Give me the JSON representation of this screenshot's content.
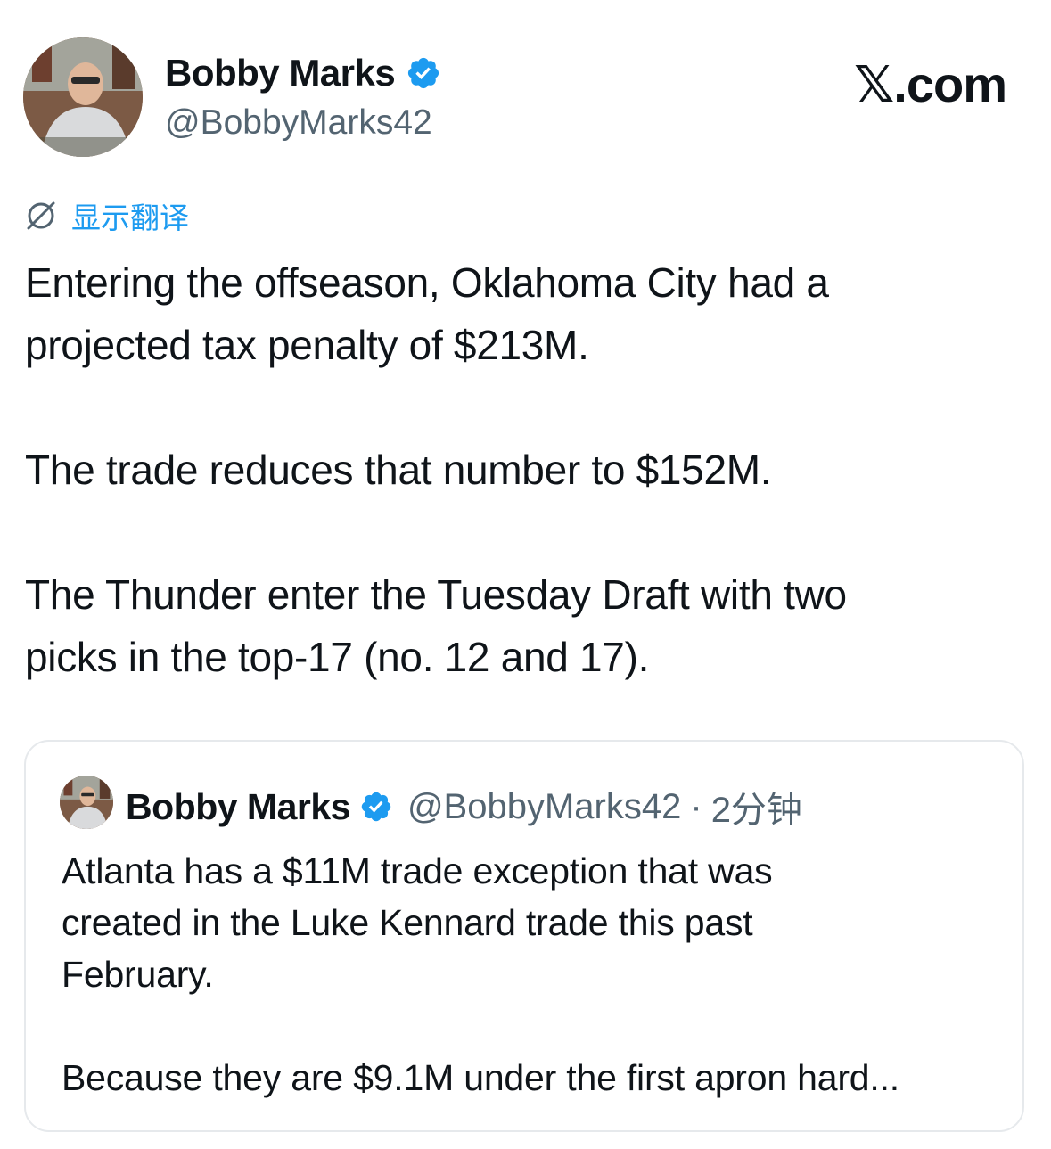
{
  "tweet": {
    "author_name": "Bobby Marks",
    "author_handle": "@BobbyMarks42",
    "brand": "𝕏.com",
    "translate_label": "显示翻译",
    "body": "Entering the offseason, Oklahoma City had a\nprojected tax penalty of $213M.\n\nThe trade reduces that number to $152M.\n\nThe Thunder enter the Tuesday Draft with two\npicks in the top-17 (no. 12 and 17)."
  },
  "quoted": {
    "author_name": "Bobby Marks",
    "author_handle": "@BobbyMarks42",
    "separator": "·",
    "time": "2分钟",
    "text": "Atlanta has a $11M trade exception that was\ncreated in the Luke Kennard trade this past\nFebruary.\n\nBecause they are $9.1M under the first apron hard..."
  },
  "icons": {
    "avatar": "profile-photo",
    "verified": "verified-badge-icon",
    "translate": "globe-icon"
  },
  "colors": {
    "accent": "#1d9bf0",
    "secondary_text": "#536471",
    "border": "#e6e9ec"
  }
}
